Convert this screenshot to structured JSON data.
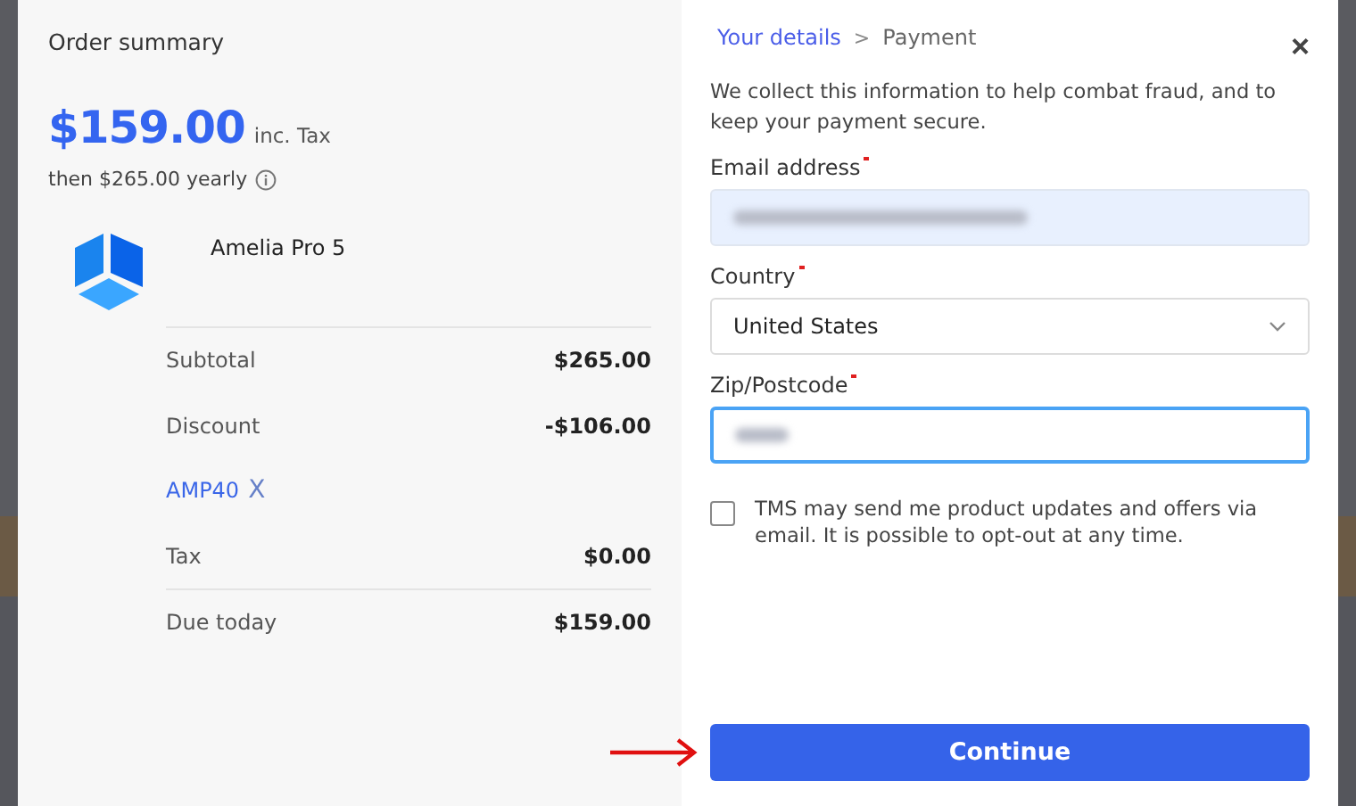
{
  "summary": {
    "title": "Order summary",
    "price": "$159.00",
    "price_note": "inc. Tax",
    "renewal": "then $265.00 yearly",
    "product": "Amelia Pro 5",
    "lines": [
      {
        "kind": "line",
        "label": "Subtotal",
        "amount": "$265.00"
      },
      {
        "kind": "line",
        "label": "Discount",
        "amount": "-$106.00"
      },
      {
        "kind": "coupon",
        "label": "AMP40",
        "remove": "X"
      },
      {
        "kind": "line",
        "label": "Tax",
        "amount": "$0.00"
      },
      {
        "kind": "total",
        "label": "Due today",
        "amount": "$159.00"
      }
    ]
  },
  "form": {
    "steps": [
      {
        "label": "Your details",
        "selected": true
      },
      {
        "label": "Payment",
        "selected": false
      }
    ],
    "separator": ">",
    "close": "×",
    "intro": "We collect this information to help combat fraud, and to keep your payment secure.",
    "fields": [
      {
        "kind": "text",
        "label": "Email address",
        "required": true,
        "value_blurred": true,
        "autofilled": true,
        "focused": false
      },
      {
        "kind": "select",
        "label": "Country",
        "required": true,
        "value": "United States",
        "focused": false
      },
      {
        "kind": "text",
        "label": "Zip/Postcode",
        "required": true,
        "value_blurred": true,
        "autofilled": false,
        "focused": true
      }
    ],
    "consent": {
      "checked": false,
      "text": "TMS may send me product updates and offers via email. It is possible to opt-out at any time."
    },
    "submit": "Continue"
  },
  "annotation": {
    "kind": "arrow"
  }
}
